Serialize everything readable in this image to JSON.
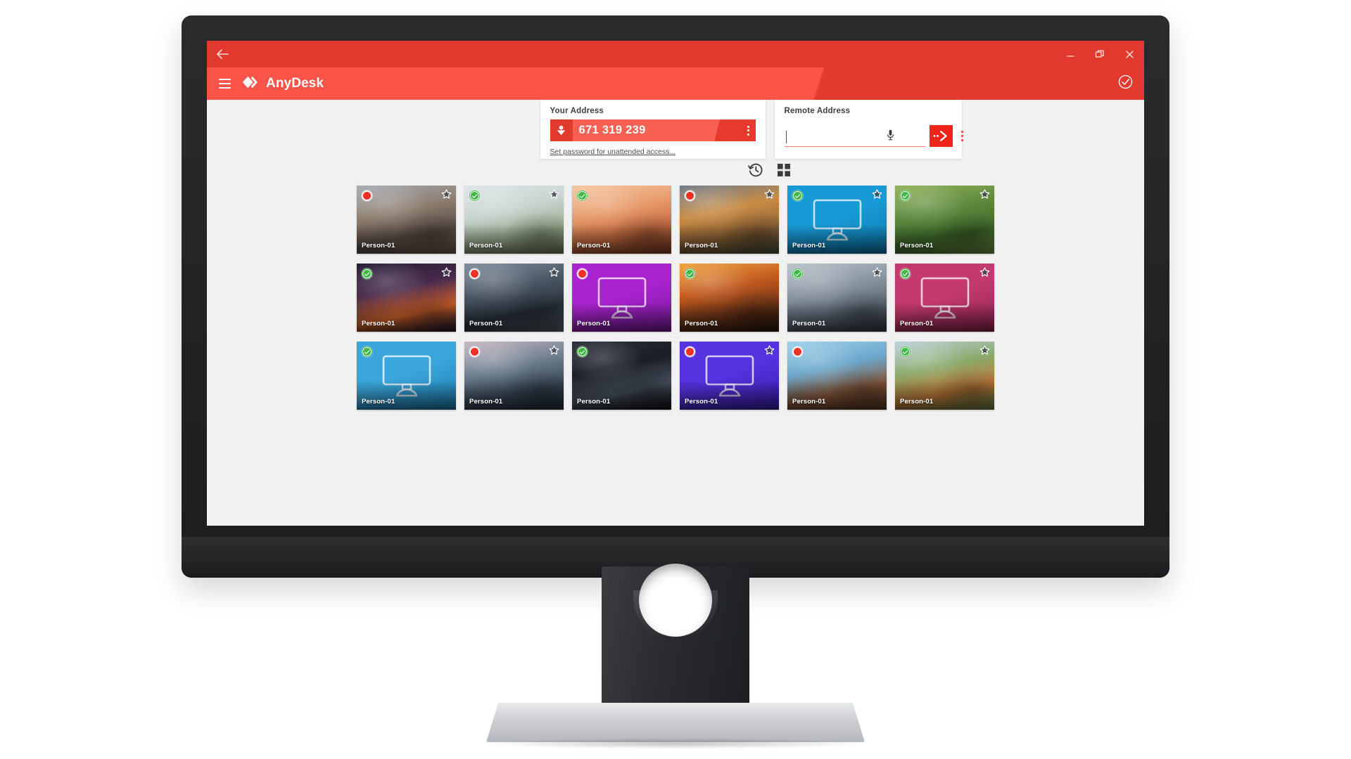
{
  "window": {
    "app_title": "AnyDesk",
    "back_icon": "back-arrow-icon",
    "menu_icon": "hamburger-menu-icon",
    "logo_icon": "anydesk-logo-icon",
    "status_icon": "check-circle-icon",
    "controls": [
      {
        "name": "minimize",
        "icon": "minimize-icon"
      },
      {
        "name": "restore",
        "icon": "restore-window-icon"
      },
      {
        "name": "close",
        "icon": "close-icon"
      }
    ]
  },
  "your_address": {
    "label": "Your Address",
    "value": "671 319 239",
    "icon": "anydesk-id-icon",
    "menu_icon": "kebab-menu-icon",
    "link": "Set password for unattended access..."
  },
  "remote_address": {
    "label": "Remote Address",
    "value": "",
    "placeholder": "",
    "mic_icon": "microphone-icon",
    "connect_icon": "connect-arrow-icon",
    "menu_icon": "kebab-menu-icon"
  },
  "toolbar": {
    "history_icon": "history-clock-icon",
    "grid_icon": "grid-view-icon"
  },
  "colors": {
    "titlebar": "#e2392f",
    "appbar": "#fc5449",
    "accent": "#f0241b",
    "online": "#43b649",
    "offline": "#ee3124",
    "screen_bg": "#f1f1f1"
  },
  "tiles": [
    {
      "name": "Person-01",
      "status": "offline",
      "starred": true,
      "kind": "photo",
      "thumb": "canyon-cliff-hiker",
      "palette": [
        "#a7adb4",
        "#8d7d6f",
        "#5b4f48",
        "#7d6a5c"
      ]
    },
    {
      "name": "Person-01",
      "status": "online",
      "starred": true,
      "kind": "photo",
      "thumb": "bench-friends-coast",
      "palette": [
        "#dfe6e8",
        "#c6d3cf",
        "#9aab8e",
        "#7d8a66"
      ]
    },
    {
      "name": "Person-01",
      "status": "online",
      "starred": false,
      "kind": "photo",
      "thumb": "desert-dunes-walker",
      "palette": [
        "#f6c9a3",
        "#e79a6a",
        "#c4693f",
        "#8e4526"
      ]
    },
    {
      "name": "Person-01",
      "status": "offline",
      "starred": true,
      "kind": "photo",
      "thumb": "mountain-peaks-sunset",
      "palette": [
        "#6d7a88",
        "#c98c45",
        "#8d6236",
        "#4e5a44"
      ]
    },
    {
      "name": "Person-01",
      "status": "online",
      "starred": true,
      "kind": "placeholder",
      "thumb": "monitor-icon",
      "palette": [
        "#189ad6",
        "#0e7cb0"
      ]
    },
    {
      "name": "Person-01",
      "status": "online",
      "starred": true,
      "kind": "photo",
      "thumb": "green-hills-walker",
      "palette": [
        "#8fb35a",
        "#5e8a3e",
        "#3f6b2c",
        "#7ca24a"
      ]
    },
    {
      "name": "Person-01",
      "status": "online",
      "starred": true,
      "kind": "photo",
      "thumb": "city-night-lights",
      "palette": [
        "#221a33",
        "#4a2b4d",
        "#d4642a",
        "#1a1430"
      ]
    },
    {
      "name": "Person-01",
      "status": "offline",
      "starred": true,
      "kind": "photo",
      "thumb": "city-dusk-aerial",
      "palette": [
        "#7e8d9c",
        "#4a5664",
        "#2a323c",
        "#606c78"
      ]
    },
    {
      "name": "Person-01",
      "status": "offline",
      "starred": false,
      "kind": "placeholder",
      "thumb": "monitor-icon",
      "palette": [
        "#a923cf",
        "#7c1a9c"
      ]
    },
    {
      "name": "Person-01",
      "status": "online",
      "starred": false,
      "kind": "photo",
      "thumb": "city-golden-sunset",
      "palette": [
        "#f0a33c",
        "#c2591f",
        "#6b3417",
        "#2a1a10"
      ]
    },
    {
      "name": "Person-01",
      "status": "online",
      "starred": true,
      "kind": "photo",
      "thumb": "skyscrapers-grey-sky",
      "palette": [
        "#b9c3cc",
        "#8894a0",
        "#5a6672",
        "#39424c"
      ]
    },
    {
      "name": "Person-01",
      "status": "online",
      "starred": true,
      "kind": "placeholder",
      "thumb": "monitor-icon",
      "palette": [
        "#c43a6e",
        "#93254f"
      ]
    },
    {
      "name": "Person-01",
      "status": "online",
      "starred": false,
      "kind": "placeholder",
      "thumb": "monitor-icon",
      "palette": [
        "#3aa6dd",
        "#1f7fae"
      ]
    },
    {
      "name": "Person-01",
      "status": "offline",
      "starred": true,
      "kind": "photo",
      "thumb": "waterfront-city-dusk",
      "palette": [
        "#c9b9c4",
        "#6f7f90",
        "#3b4a5a",
        "#24303c"
      ]
    },
    {
      "name": "Person-01",
      "status": "online",
      "starred": false,
      "kind": "photo",
      "thumb": "twin-towers-night",
      "palette": [
        "#2a2f3a",
        "#1a1d25",
        "#4a5360",
        "#0f1116"
      ]
    },
    {
      "name": "Person-01",
      "status": "offline",
      "starred": true,
      "kind": "placeholder",
      "thumb": "monitor-icon",
      "palette": [
        "#5533e0",
        "#3a1fae"
      ]
    },
    {
      "name": "Person-01",
      "status": "offline",
      "starred": false,
      "kind": "photo",
      "thumb": "cliff-person-arms-up",
      "palette": [
        "#9fd2ea",
        "#6aa7cc",
        "#8a5a3c",
        "#5d3a24"
      ]
    },
    {
      "name": "Person-01",
      "status": "online",
      "starred": true,
      "kind": "photo",
      "thumb": "village-aerial-autumn",
      "palette": [
        "#bcd2e0",
        "#8aa96a",
        "#c07a3a",
        "#6d8a4a"
      ]
    }
  ]
}
